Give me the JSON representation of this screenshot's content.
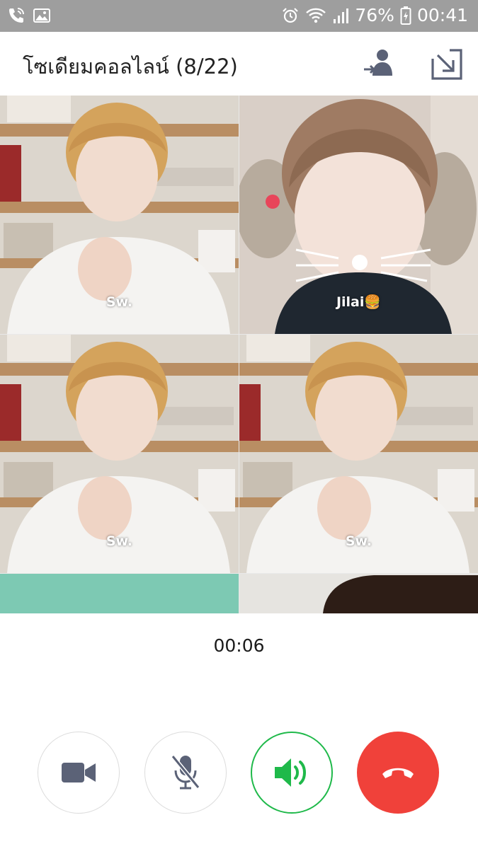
{
  "status_bar": {
    "battery": "76%",
    "time": "00:41",
    "icons": [
      "phone-wifi-icon",
      "image-icon",
      "alarm-icon",
      "wifi-icon",
      "signal-icon",
      "battery-charging-icon"
    ]
  },
  "header": {
    "title": "โซเดียมคอลไลน์ (8/22)",
    "icons": [
      "invite-member-icon",
      "minimize-icon"
    ]
  },
  "participants": [
    {
      "name": "Sw."
    },
    {
      "name": "Jilai🍔"
    },
    {
      "name": "Sw."
    },
    {
      "name": "Sw."
    },
    {
      "name": ""
    },
    {
      "name": ""
    }
  ],
  "call": {
    "timer": "00:06"
  },
  "controls": {
    "icons": [
      "video-camera-icon",
      "microphone-muted-icon",
      "speaker-icon",
      "end-call-icon"
    ],
    "colors": {
      "speaker_active": "#1fb94a",
      "end_call": "#f0413a",
      "icon_gray": "#5b6277"
    }
  }
}
